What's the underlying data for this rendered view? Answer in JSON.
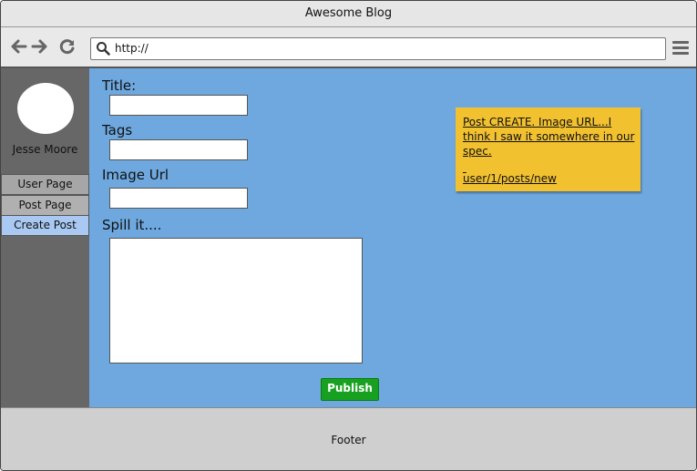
{
  "window": {
    "title": "Awesome Blog"
  },
  "browser": {
    "url": "http://",
    "icons": [
      "back-arrow-icon",
      "forward-arrow-icon",
      "reload-icon",
      "search-icon",
      "hamburger-menu-icon"
    ]
  },
  "sidebar": {
    "user_name": "Jesse Moore",
    "items": [
      {
        "label": "User Page"
      },
      {
        "label": "Post Page"
      },
      {
        "label": "Create Post",
        "selected": true
      }
    ]
  },
  "form": {
    "title_label": "Title:",
    "tags_label": "Tags",
    "image_url_label": "Image Url",
    "body_label": "Spill it....",
    "title_value": "",
    "tags_value": "",
    "image_url_value": "",
    "body_value": "",
    "publish_label": "Publish"
  },
  "note": {
    "text": "Post CREATE. Image URL...I think I saw it somewhere in our spec.",
    "link": "user/1/posts/new"
  },
  "footer": {
    "label": "Footer"
  },
  "colors": {
    "main_bg": "#6ea8de",
    "sidebar_bg": "#676767",
    "selected_item": "#a9c8f2",
    "publish": "#18a121",
    "note": "#f2c130",
    "footer_bg": "#cfcfcf"
  }
}
